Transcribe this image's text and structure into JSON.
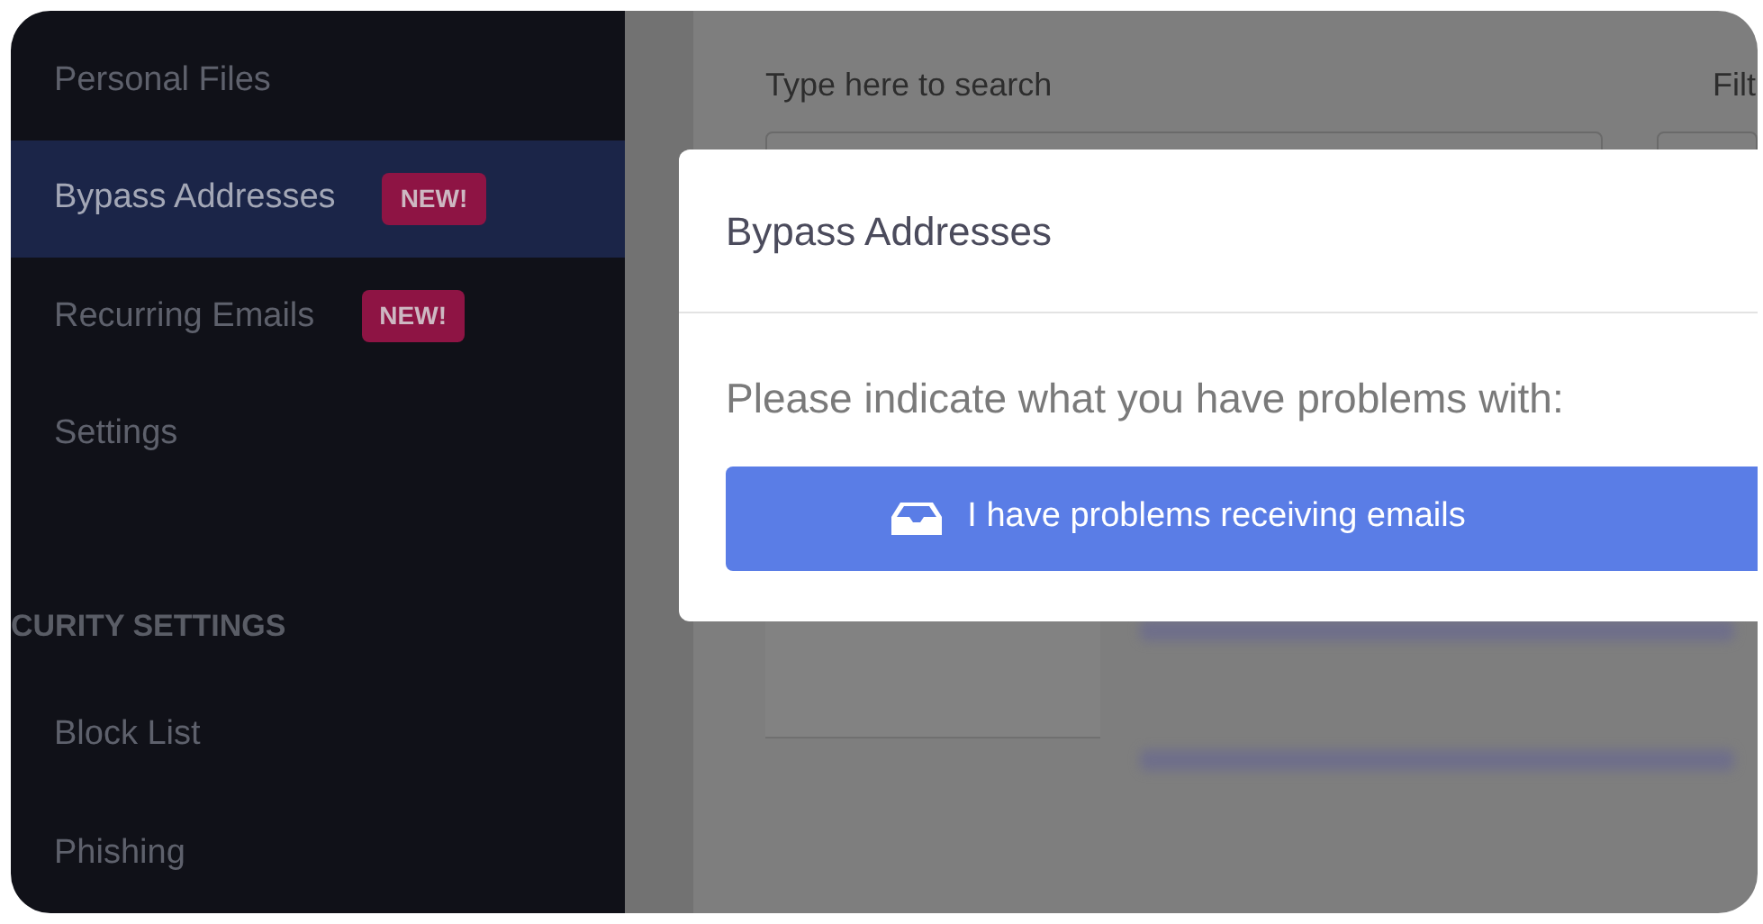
{
  "sidebar": {
    "items": [
      {
        "label": "Personal Files",
        "selected": false
      },
      {
        "label": "Bypass Addresses",
        "selected": true,
        "badge": "NEW!"
      },
      {
        "label": "Recurring Emails",
        "selected": false,
        "badge": "NEW!"
      },
      {
        "label": "Settings",
        "selected": false
      }
    ],
    "section": {
      "heading": "CURITY SETTINGS",
      "items": [
        {
          "label": "Block List",
          "selected": false
        },
        {
          "label": "Phishing",
          "selected": false
        }
      ]
    }
  },
  "search": {
    "label": "Type here to search"
  },
  "filter": {
    "label": "Filt"
  },
  "modal": {
    "title": "Bypass Addresses",
    "prompt": "Please indicate what you have problems with:",
    "button": "I have problems receiving emails"
  }
}
